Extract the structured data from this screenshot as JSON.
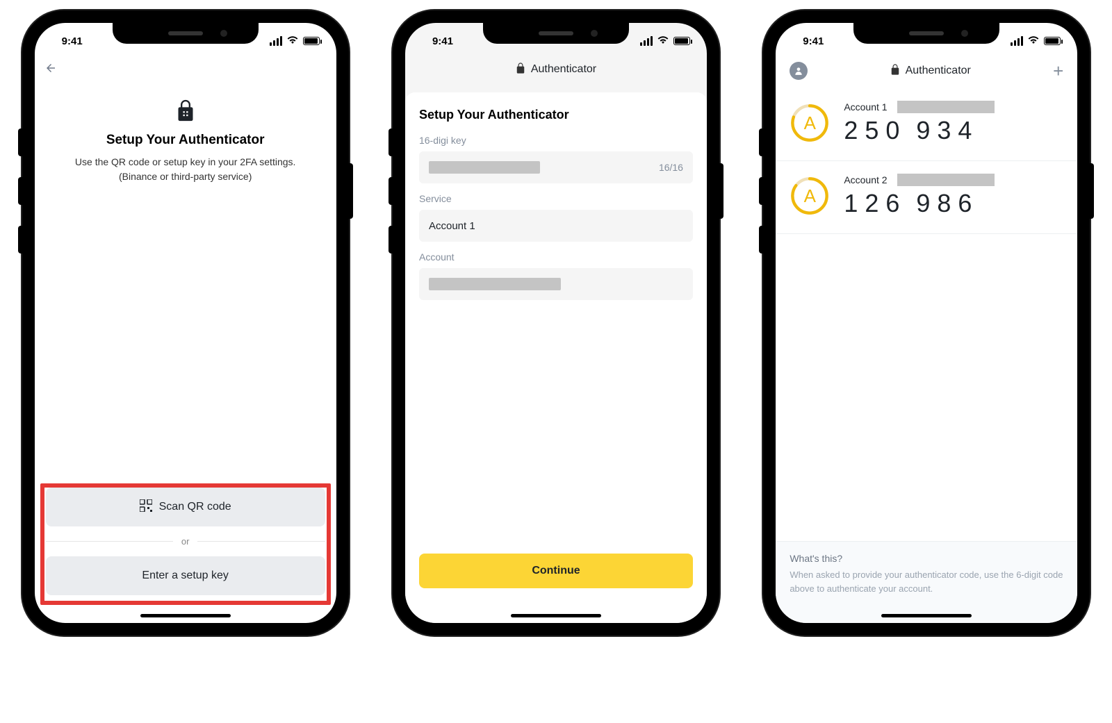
{
  "statusbar": {
    "time": "9:41"
  },
  "screen1": {
    "title": "Setup Your Authenticator",
    "subtitle_line1": "Use the QR code or setup key in your 2FA settings.",
    "subtitle_line2": "(Binance or third-party service)",
    "scan_label": "Scan QR code",
    "or_label": "or",
    "enter_key_label": "Enter a setup key"
  },
  "screen2": {
    "app_title": "Authenticator",
    "heading": "Setup Your Authenticator",
    "field_key_label": "16-digi key",
    "field_key_counter": "16/16",
    "field_service_label": "Service",
    "field_service_value": "Account 1",
    "field_account_label": "Account",
    "continue_label": "Continue"
  },
  "screen3": {
    "app_title": "Authenticator",
    "accounts": [
      {
        "letter": "A",
        "name": "Account 1",
        "code_a": "250",
        "code_b": "934",
        "progress": 0.8
      },
      {
        "letter": "A",
        "name": "Account 2",
        "code_a": "126",
        "code_b": "986",
        "progress": 0.85
      }
    ],
    "help_title": "What's this?",
    "help_body": "When asked to provide your authenticator code, use the 6-digit code above to authenticate your account."
  }
}
